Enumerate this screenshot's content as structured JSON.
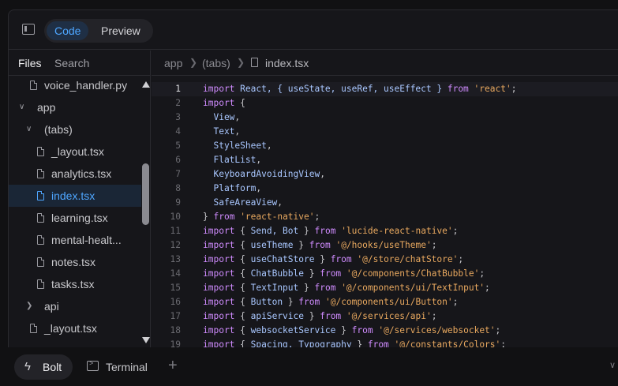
{
  "header": {
    "tabs": [
      {
        "label": "Code",
        "active": true
      },
      {
        "label": "Preview",
        "active": false
      }
    ]
  },
  "sidebar": {
    "tabs": [
      {
        "label": "Files",
        "active": true
      },
      {
        "label": "Search",
        "active": false
      }
    ],
    "tree": [
      {
        "label": "voice_handler.py",
        "kind": "file",
        "depth": 1
      },
      {
        "label": "app",
        "kind": "folder",
        "depth": 0,
        "expanded": true
      },
      {
        "label": "(tabs)",
        "kind": "folder",
        "depth": 1,
        "expanded": true
      },
      {
        "label": "_layout.tsx",
        "kind": "file",
        "depth": 2
      },
      {
        "label": "analytics.tsx",
        "kind": "file",
        "depth": 2
      },
      {
        "label": "index.tsx",
        "kind": "file",
        "depth": 2,
        "active": true
      },
      {
        "label": "learning.tsx",
        "kind": "file",
        "depth": 2
      },
      {
        "label": "mental-healt...",
        "kind": "file",
        "depth": 2
      },
      {
        "label": "notes.tsx",
        "kind": "file",
        "depth": 2
      },
      {
        "label": "tasks.tsx",
        "kind": "file",
        "depth": 2
      },
      {
        "label": "api",
        "kind": "folder",
        "depth": 1,
        "expanded": false
      },
      {
        "label": "_layout.tsx",
        "kind": "file",
        "depth": 1
      }
    ]
  },
  "editor": {
    "breadcrumb": [
      "app",
      "(tabs)",
      "index.tsx"
    ],
    "current_line": 1,
    "lines": [
      {
        "n": "1",
        "parts": [
          [
            "kw",
            "import"
          ],
          [
            "id",
            " React, { useState, useRef, useEffect } "
          ],
          [
            "kw",
            "from"
          ],
          [
            "pl",
            " "
          ],
          [
            "str",
            "'react'"
          ],
          [
            "pl",
            ";"
          ]
        ]
      },
      {
        "n": "2",
        "parts": [
          [
            "kw",
            "import"
          ],
          [
            "pl",
            " {"
          ]
        ]
      },
      {
        "n": "3",
        "parts": [
          [
            "id",
            "  View"
          ],
          [
            "pl",
            ","
          ]
        ]
      },
      {
        "n": "4",
        "parts": [
          [
            "id",
            "  Text"
          ],
          [
            "pl",
            ","
          ]
        ]
      },
      {
        "n": "5",
        "parts": [
          [
            "id",
            "  StyleSheet"
          ],
          [
            "pl",
            ","
          ]
        ]
      },
      {
        "n": "6",
        "parts": [
          [
            "id",
            "  FlatList"
          ],
          [
            "pl",
            ","
          ]
        ]
      },
      {
        "n": "7",
        "parts": [
          [
            "id",
            "  KeyboardAvoidingView"
          ],
          [
            "pl",
            ","
          ]
        ]
      },
      {
        "n": "8",
        "parts": [
          [
            "id",
            "  Platform"
          ],
          [
            "pl",
            ","
          ]
        ]
      },
      {
        "n": "9",
        "parts": [
          [
            "id",
            "  SafeAreaView"
          ],
          [
            "pl",
            ","
          ]
        ]
      },
      {
        "n": "10",
        "parts": [
          [
            "pl",
            "} "
          ],
          [
            "kw",
            "from"
          ],
          [
            "pl",
            " "
          ],
          [
            "str",
            "'react-native'"
          ],
          [
            "pl",
            ";"
          ]
        ]
      },
      {
        "n": "11",
        "parts": [
          [
            "kw",
            "import"
          ],
          [
            "pl",
            " { "
          ],
          [
            "id",
            "Send, Bot"
          ],
          [
            "pl",
            " } "
          ],
          [
            "kw",
            "from"
          ],
          [
            "pl",
            " "
          ],
          [
            "str",
            "'lucide-react-native'"
          ],
          [
            "pl",
            ";"
          ]
        ]
      },
      {
        "n": "12",
        "parts": [
          [
            "kw",
            "import"
          ],
          [
            "pl",
            " { "
          ],
          [
            "id",
            "useTheme"
          ],
          [
            "pl",
            " } "
          ],
          [
            "kw",
            "from"
          ],
          [
            "pl",
            " "
          ],
          [
            "str",
            "'@/hooks/useTheme'"
          ],
          [
            "pl",
            ";"
          ]
        ]
      },
      {
        "n": "13",
        "parts": [
          [
            "kw",
            "import"
          ],
          [
            "pl",
            " { "
          ],
          [
            "id",
            "useChatStore"
          ],
          [
            "pl",
            " } "
          ],
          [
            "kw",
            "from"
          ],
          [
            "pl",
            " "
          ],
          [
            "str",
            "'@/store/chatStore'"
          ],
          [
            "pl",
            ";"
          ]
        ]
      },
      {
        "n": "14",
        "parts": [
          [
            "kw",
            "import"
          ],
          [
            "pl",
            " { "
          ],
          [
            "id",
            "ChatBubble"
          ],
          [
            "pl",
            " } "
          ],
          [
            "kw",
            "from"
          ],
          [
            "pl",
            " "
          ],
          [
            "str",
            "'@/components/ChatBubble'"
          ],
          [
            "pl",
            ";"
          ]
        ]
      },
      {
        "n": "15",
        "parts": [
          [
            "kw",
            "import"
          ],
          [
            "pl",
            " { "
          ],
          [
            "id",
            "TextInput"
          ],
          [
            "pl",
            " } "
          ],
          [
            "kw",
            "from"
          ],
          [
            "pl",
            " "
          ],
          [
            "str",
            "'@/components/ui/TextInput'"
          ],
          [
            "pl",
            ";"
          ]
        ]
      },
      {
        "n": "16",
        "parts": [
          [
            "kw",
            "import"
          ],
          [
            "pl",
            " { "
          ],
          [
            "id",
            "Button"
          ],
          [
            "pl",
            " } "
          ],
          [
            "kw",
            "from"
          ],
          [
            "pl",
            " "
          ],
          [
            "str",
            "'@/components/ui/Button'"
          ],
          [
            "pl",
            ";"
          ]
        ]
      },
      {
        "n": "17",
        "parts": [
          [
            "kw",
            "import"
          ],
          [
            "pl",
            " { "
          ],
          [
            "id",
            "apiService"
          ],
          [
            "pl",
            " } "
          ],
          [
            "kw",
            "from"
          ],
          [
            "pl",
            " "
          ],
          [
            "str",
            "'@/services/api'"
          ],
          [
            "pl",
            ";"
          ]
        ]
      },
      {
        "n": "18",
        "parts": [
          [
            "kw",
            "import"
          ],
          [
            "pl",
            " { "
          ],
          [
            "id",
            "websocketService"
          ],
          [
            "pl",
            " } "
          ],
          [
            "kw",
            "from"
          ],
          [
            "pl",
            " "
          ],
          [
            "str",
            "'@/services/websocket'"
          ],
          [
            "pl",
            ";"
          ]
        ]
      },
      {
        "n": "19",
        "parts": [
          [
            "kw",
            "import"
          ],
          [
            "pl",
            " { "
          ],
          [
            "id",
            "Spacing, Typography"
          ],
          [
            "pl",
            " } "
          ],
          [
            "kw",
            "from"
          ],
          [
            "pl",
            " "
          ],
          [
            "str",
            "'@/constants/Colors'"
          ],
          [
            "pl",
            ";"
          ]
        ]
      }
    ]
  },
  "bottom": {
    "bolt_label": "Bolt",
    "terminal_label": "Terminal"
  },
  "icons": {
    "panel": "sidebar-toggle-icon",
    "file": "file-icon",
    "bolt": "lightning-bolt-icon",
    "terminal": "terminal-icon",
    "add": "plus-icon",
    "collapse": "chevron-down-icon"
  },
  "colors": {
    "accent": "#4ea6ff",
    "keyword": "#d08cff",
    "string": "#e8a85f",
    "identifier": "#a9c7ff",
    "background": "#16161a"
  }
}
